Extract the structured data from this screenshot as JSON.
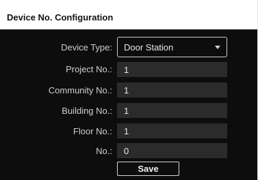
{
  "header": {
    "title": "Device No. Configuration"
  },
  "form": {
    "device_type": {
      "label": "Device Type:",
      "value": "Door Station",
      "icon": "chevron-down-icon"
    },
    "project_no": {
      "label": "Project No.:",
      "value": "1"
    },
    "community_no": {
      "label": "Community No.:",
      "value": "1"
    },
    "building_no": {
      "label": "Building No.:",
      "value": "1"
    },
    "floor_no": {
      "label": "Floor No.:",
      "value": "1"
    },
    "no": {
      "label": "No.:",
      "value": "0"
    },
    "save_label": "Save"
  }
}
